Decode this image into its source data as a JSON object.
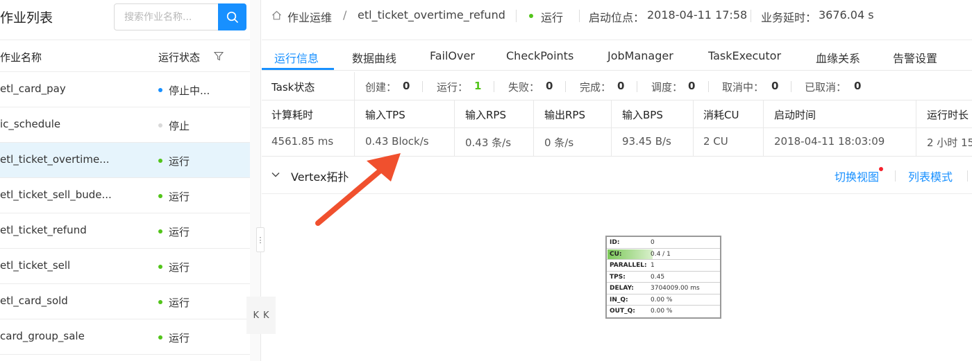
{
  "left": {
    "title": "作业列表",
    "search": {
      "placeholder": "搜索作业名称..."
    },
    "columns": {
      "name": "作业名称",
      "status": "运行状态"
    },
    "jobs": [
      {
        "name": "etl_card_pay",
        "status": "停止中...",
        "dot_color": "#1890ff",
        "active": false
      },
      {
        "name": "ic_schedule",
        "status": "停止",
        "dot_color": "#d9d9d9",
        "active": false
      },
      {
        "name": "etl_ticket_overtime...",
        "status": "运行",
        "dot_color": "#52c41a",
        "active": true
      },
      {
        "name": "etl_ticket_sell_bude...",
        "status": "运行",
        "dot_color": "#52c41a",
        "active": false
      },
      {
        "name": "etl_ticket_refund",
        "status": "运行",
        "dot_color": "#52c41a",
        "active": false
      },
      {
        "name": "etl_ticket_sell",
        "status": "运行",
        "dot_color": "#52c41a",
        "active": false
      },
      {
        "name": "etl_card_sold",
        "status": "运行",
        "dot_color": "#52c41a",
        "active": false
      },
      {
        "name": "card_group_sale",
        "status": "运行",
        "dot_color": "#52c41a",
        "active": false
      }
    ]
  },
  "breadcrumb": {
    "section": "作业运维",
    "separator": "/",
    "job": "etl_ticket_overtime_refund",
    "status": "运行",
    "start_label": "启动位点：",
    "start_value": "2018-04-11 17:58",
    "delay_label": "业务延时：",
    "delay_value": "3676.04 s"
  },
  "tabs": [
    "运行信息",
    "数据曲线",
    "FailOver",
    "CheckPoints",
    "JobManager",
    "TaskExecutor",
    "血缘关系",
    "告警设置"
  ],
  "task": {
    "label": "Task状态",
    "counts": [
      {
        "label": "创建：",
        "value": "0"
      },
      {
        "label": "运行：",
        "value": "1"
      },
      {
        "label": "失败：",
        "value": "0"
      },
      {
        "label": "完成：",
        "value": "0"
      },
      {
        "label": "调度：",
        "value": "0"
      },
      {
        "label": "取消中：",
        "value": "0"
      },
      {
        "label": "已取消：",
        "value": "0"
      }
    ]
  },
  "metrics": {
    "headers": [
      "计算耗时",
      "输入TPS",
      "输入RPS",
      "输出RPS",
      "输入BPS",
      "消耗CU",
      "启动时间",
      "运行时长"
    ],
    "values": [
      "4561.85 ms",
      "0.43 Block/s",
      "0.43 条/s",
      "0 条/s",
      "93.45 B/s",
      "2 CU",
      "2018-04-11 18:03:09",
      "2 小时 15"
    ]
  },
  "vertex": {
    "title": "Vertex拓扑",
    "switch_view": "切换视图",
    "list_mode": "列表模式"
  },
  "node": {
    "rows": [
      {
        "key": "ID:",
        "value": "0"
      },
      {
        "key": "CU:",
        "value": "0.4 / 1"
      },
      {
        "key": "PARALLEL:",
        "value": "1"
      },
      {
        "key": "TPS:",
        "value": "0.45"
      },
      {
        "key": "DELAY:",
        "value": "3704009.00 ms"
      },
      {
        "key": "IN_Q:",
        "value": "0.00 %"
      },
      {
        "key": "OUT_Q:",
        "value": "0.00 %"
      }
    ],
    "cu_fraction": 0.4
  },
  "colors": {
    "primary": "#1890ff",
    "running": "#52c41a",
    "arrow": "#f0502e",
    "badge": "#f5222d"
  }
}
